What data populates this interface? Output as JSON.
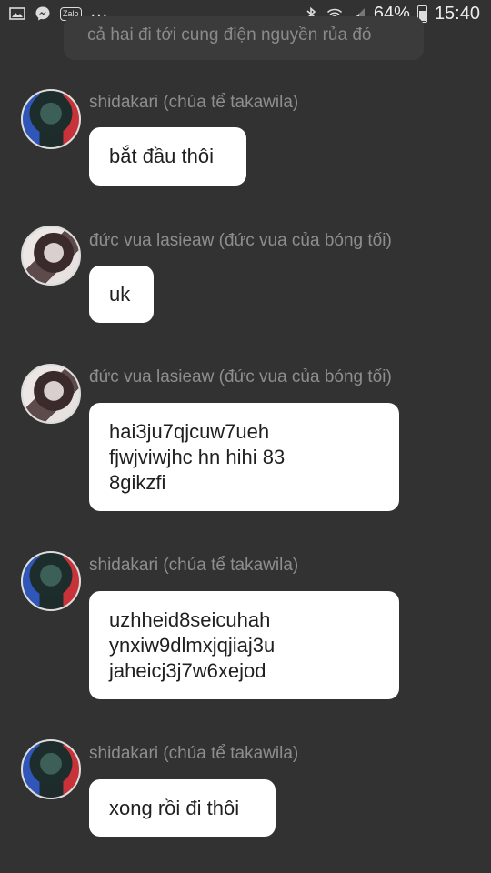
{
  "status_bar": {
    "left_icons": [
      "gallery-icon",
      "messenger-icon",
      "zalo-icon"
    ],
    "zalo_label": "Zalo",
    "overflow": "...",
    "right_icons": [
      "bluetooth-icon",
      "wifi-icon",
      "signal-icon",
      "battery-icon"
    ],
    "battery": "64%",
    "time": "15:40"
  },
  "top_bubble": {
    "text": "cả hai đi tới cung điện nguyền rủa đó"
  },
  "messages": [
    {
      "sender": "shidakari (chúa tể takawila)",
      "avatar": "shidakari-avatar",
      "lines": [
        "bắt đầu thôi"
      ]
    },
    {
      "sender": "đức vua lasieaw (đức vua của bóng tối)",
      "avatar": "lasieaw-avatar",
      "lines": [
        "uk"
      ]
    },
    {
      "sender": "đức vua lasieaw (đức vua của bóng tối)",
      "avatar": "lasieaw-avatar",
      "lines": [
        "hai3ju7qjcuw7ueh",
        "fjwjviwjhc hn hihi 83",
        "8gikzfi"
      ]
    },
    {
      "sender": "shidakari (chúa tể takawila)",
      "avatar": "shidakari-avatar",
      "lines": [
        "uzhheid8seicuhah",
        "ynxiw9dlmxjqjiaj3u",
        "jaheicj3j7w6xejod"
      ]
    },
    {
      "sender": "shidakari (chúa tể takawila)",
      "avatar": "shidakari-avatar",
      "lines": [
        "xong rồi đi thôi"
      ]
    }
  ]
}
